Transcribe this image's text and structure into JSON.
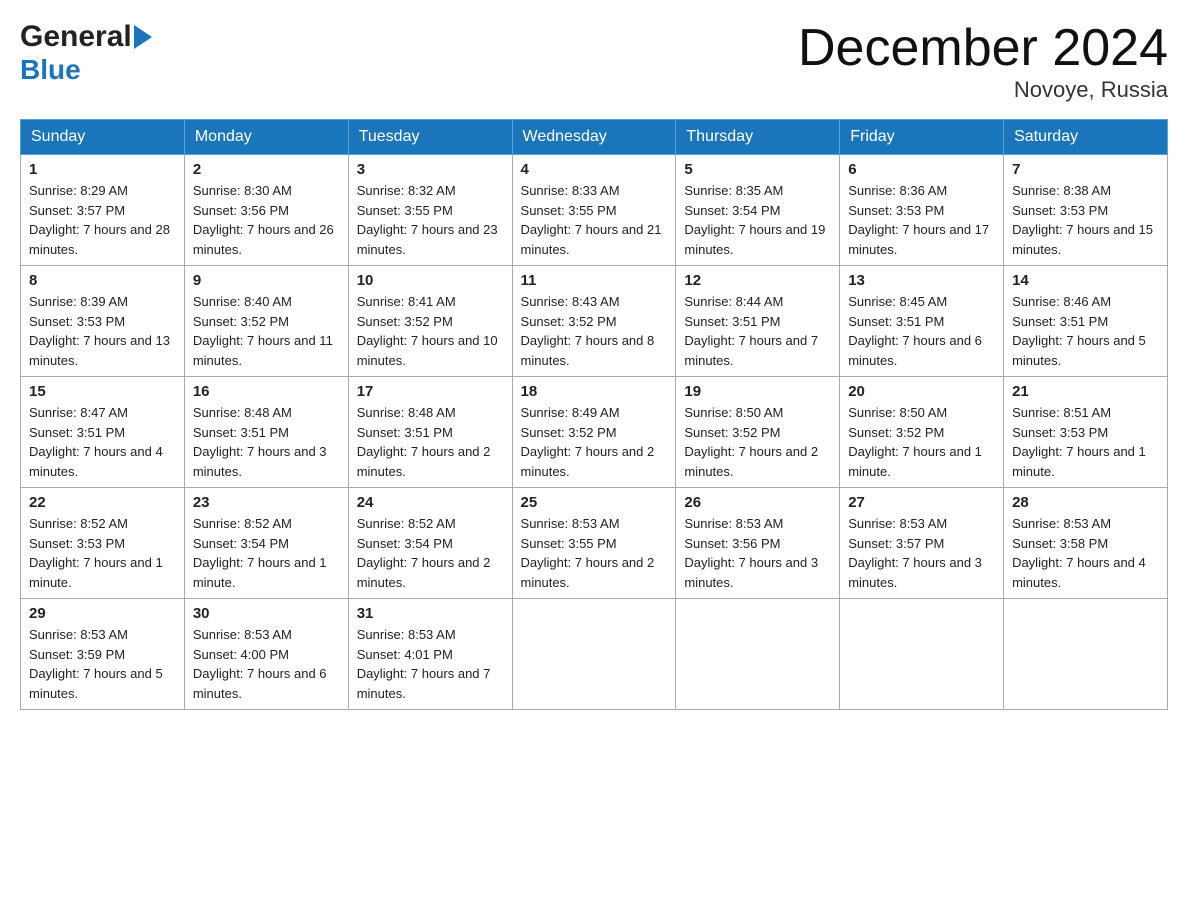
{
  "logo": {
    "general": "General",
    "blue": "Blue"
  },
  "header": {
    "month": "December 2024",
    "location": "Novoye, Russia"
  },
  "weekdays": [
    "Sunday",
    "Monday",
    "Tuesday",
    "Wednesday",
    "Thursday",
    "Friday",
    "Saturday"
  ],
  "weeks": [
    [
      {
        "day": "1",
        "sunrise": "Sunrise: 8:29 AM",
        "sunset": "Sunset: 3:57 PM",
        "daylight": "Daylight: 7 hours and 28 minutes."
      },
      {
        "day": "2",
        "sunrise": "Sunrise: 8:30 AM",
        "sunset": "Sunset: 3:56 PM",
        "daylight": "Daylight: 7 hours and 26 minutes."
      },
      {
        "day": "3",
        "sunrise": "Sunrise: 8:32 AM",
        "sunset": "Sunset: 3:55 PM",
        "daylight": "Daylight: 7 hours and 23 minutes."
      },
      {
        "day": "4",
        "sunrise": "Sunrise: 8:33 AM",
        "sunset": "Sunset: 3:55 PM",
        "daylight": "Daylight: 7 hours and 21 minutes."
      },
      {
        "day": "5",
        "sunrise": "Sunrise: 8:35 AM",
        "sunset": "Sunset: 3:54 PM",
        "daylight": "Daylight: 7 hours and 19 minutes."
      },
      {
        "day": "6",
        "sunrise": "Sunrise: 8:36 AM",
        "sunset": "Sunset: 3:53 PM",
        "daylight": "Daylight: 7 hours and 17 minutes."
      },
      {
        "day": "7",
        "sunrise": "Sunrise: 8:38 AM",
        "sunset": "Sunset: 3:53 PM",
        "daylight": "Daylight: 7 hours and 15 minutes."
      }
    ],
    [
      {
        "day": "8",
        "sunrise": "Sunrise: 8:39 AM",
        "sunset": "Sunset: 3:53 PM",
        "daylight": "Daylight: 7 hours and 13 minutes."
      },
      {
        "day": "9",
        "sunrise": "Sunrise: 8:40 AM",
        "sunset": "Sunset: 3:52 PM",
        "daylight": "Daylight: 7 hours and 11 minutes."
      },
      {
        "day": "10",
        "sunrise": "Sunrise: 8:41 AM",
        "sunset": "Sunset: 3:52 PM",
        "daylight": "Daylight: 7 hours and 10 minutes."
      },
      {
        "day": "11",
        "sunrise": "Sunrise: 8:43 AM",
        "sunset": "Sunset: 3:52 PM",
        "daylight": "Daylight: 7 hours and 8 minutes."
      },
      {
        "day": "12",
        "sunrise": "Sunrise: 8:44 AM",
        "sunset": "Sunset: 3:51 PM",
        "daylight": "Daylight: 7 hours and 7 minutes."
      },
      {
        "day": "13",
        "sunrise": "Sunrise: 8:45 AM",
        "sunset": "Sunset: 3:51 PM",
        "daylight": "Daylight: 7 hours and 6 minutes."
      },
      {
        "day": "14",
        "sunrise": "Sunrise: 8:46 AM",
        "sunset": "Sunset: 3:51 PM",
        "daylight": "Daylight: 7 hours and 5 minutes."
      }
    ],
    [
      {
        "day": "15",
        "sunrise": "Sunrise: 8:47 AM",
        "sunset": "Sunset: 3:51 PM",
        "daylight": "Daylight: 7 hours and 4 minutes."
      },
      {
        "day": "16",
        "sunrise": "Sunrise: 8:48 AM",
        "sunset": "Sunset: 3:51 PM",
        "daylight": "Daylight: 7 hours and 3 minutes."
      },
      {
        "day": "17",
        "sunrise": "Sunrise: 8:48 AM",
        "sunset": "Sunset: 3:51 PM",
        "daylight": "Daylight: 7 hours and 2 minutes."
      },
      {
        "day": "18",
        "sunrise": "Sunrise: 8:49 AM",
        "sunset": "Sunset: 3:52 PM",
        "daylight": "Daylight: 7 hours and 2 minutes."
      },
      {
        "day": "19",
        "sunrise": "Sunrise: 8:50 AM",
        "sunset": "Sunset: 3:52 PM",
        "daylight": "Daylight: 7 hours and 2 minutes."
      },
      {
        "day": "20",
        "sunrise": "Sunrise: 8:50 AM",
        "sunset": "Sunset: 3:52 PM",
        "daylight": "Daylight: 7 hours and 1 minute."
      },
      {
        "day": "21",
        "sunrise": "Sunrise: 8:51 AM",
        "sunset": "Sunset: 3:53 PM",
        "daylight": "Daylight: 7 hours and 1 minute."
      }
    ],
    [
      {
        "day": "22",
        "sunrise": "Sunrise: 8:52 AM",
        "sunset": "Sunset: 3:53 PM",
        "daylight": "Daylight: 7 hours and 1 minute."
      },
      {
        "day": "23",
        "sunrise": "Sunrise: 8:52 AM",
        "sunset": "Sunset: 3:54 PM",
        "daylight": "Daylight: 7 hours and 1 minute."
      },
      {
        "day": "24",
        "sunrise": "Sunrise: 8:52 AM",
        "sunset": "Sunset: 3:54 PM",
        "daylight": "Daylight: 7 hours and 2 minutes."
      },
      {
        "day": "25",
        "sunrise": "Sunrise: 8:53 AM",
        "sunset": "Sunset: 3:55 PM",
        "daylight": "Daylight: 7 hours and 2 minutes."
      },
      {
        "day": "26",
        "sunrise": "Sunrise: 8:53 AM",
        "sunset": "Sunset: 3:56 PM",
        "daylight": "Daylight: 7 hours and 3 minutes."
      },
      {
        "day": "27",
        "sunrise": "Sunrise: 8:53 AM",
        "sunset": "Sunset: 3:57 PM",
        "daylight": "Daylight: 7 hours and 3 minutes."
      },
      {
        "day": "28",
        "sunrise": "Sunrise: 8:53 AM",
        "sunset": "Sunset: 3:58 PM",
        "daylight": "Daylight: 7 hours and 4 minutes."
      }
    ],
    [
      {
        "day": "29",
        "sunrise": "Sunrise: 8:53 AM",
        "sunset": "Sunset: 3:59 PM",
        "daylight": "Daylight: 7 hours and 5 minutes."
      },
      {
        "day": "30",
        "sunrise": "Sunrise: 8:53 AM",
        "sunset": "Sunset: 4:00 PM",
        "daylight": "Daylight: 7 hours and 6 minutes."
      },
      {
        "day": "31",
        "sunrise": "Sunrise: 8:53 AM",
        "sunset": "Sunset: 4:01 PM",
        "daylight": "Daylight: 7 hours and 7 minutes."
      },
      null,
      null,
      null,
      null
    ]
  ]
}
